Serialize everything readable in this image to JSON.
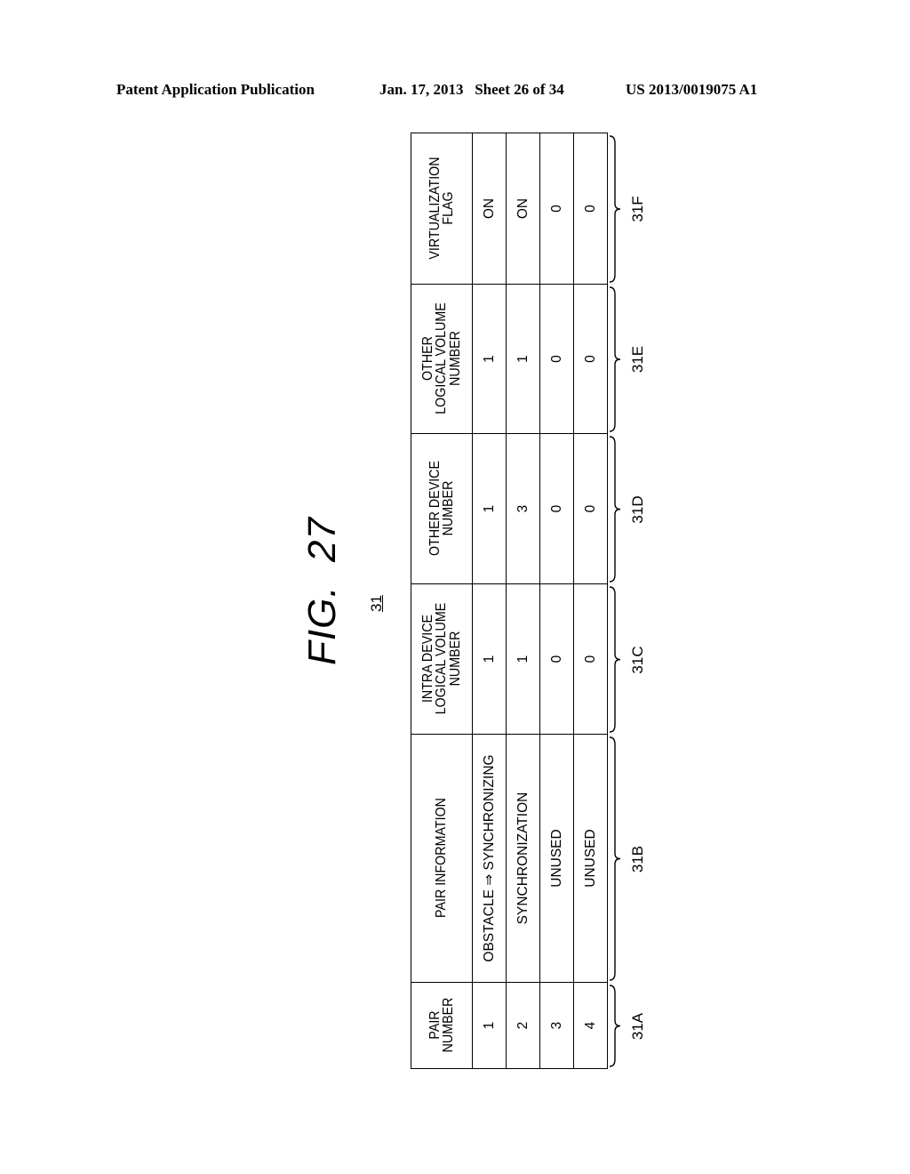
{
  "header": {
    "publication": "Patent Application Publication",
    "date_sheet": "Jan. 17, 2013   Sheet 26 of 34",
    "patent_number": "US 2013/0019075 A1"
  },
  "figure": {
    "title": "FIG.  27",
    "reference": "31"
  },
  "table": {
    "columns": [
      {
        "header": "PAIR\nNUMBER",
        "ref": "31A"
      },
      {
        "header": "PAIR INFORMATION",
        "ref": "31B"
      },
      {
        "header": "INTRA DEVICE\nLOGICAL VOLUME\nNUMBER",
        "ref": "31C"
      },
      {
        "header": "OTHER DEVICE\nNUMBER",
        "ref": "31D"
      },
      {
        "header": "OTHER\nLOGICAL VOLUME\nNUMBER",
        "ref": "31E"
      },
      {
        "header": "VIRTUALIZATION\nFLAG",
        "ref": "31F"
      }
    ],
    "rows": [
      [
        "1",
        "OBSTACLE ⇒ SYNCHRONIZING",
        "1",
        "1",
        "1",
        "ON"
      ],
      [
        "2",
        "SYNCHRONIZATION",
        "1",
        "3",
        "1",
        "ON"
      ],
      [
        "3",
        "UNUSED",
        "0",
        "0",
        "0",
        "0"
      ],
      [
        "4",
        "UNUSED",
        "0",
        "0",
        "0",
        "0"
      ]
    ]
  }
}
